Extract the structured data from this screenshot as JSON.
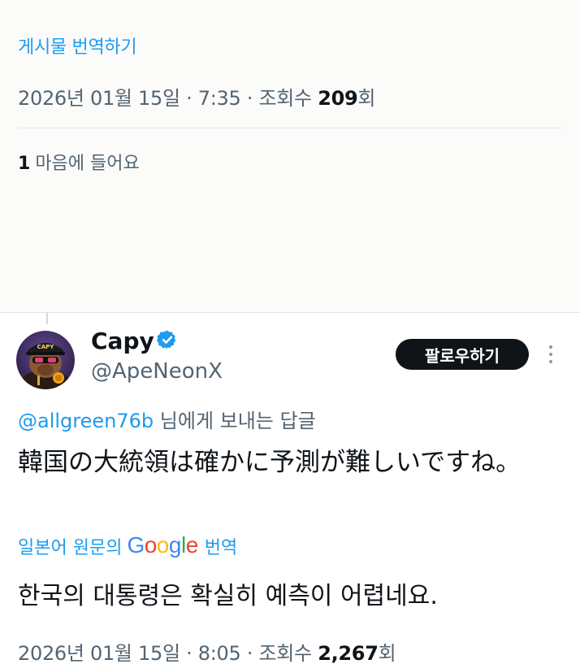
{
  "top_post": {
    "translate_label": "게시물 번역하기",
    "date": "2026년 01월 15일",
    "time": "7:35",
    "views_prefix": "조회수",
    "views_count": "209",
    "views_suffix": "회",
    "likes_count": "1",
    "likes_label": "마음에 들어요"
  },
  "reply": {
    "display_name": "Capy",
    "handle": "@ApeNeonX",
    "follow_label": "팔로우하기",
    "replying_to_mention": "@allgreen76b",
    "replying_to_suffix": "님에게 보내는 답글",
    "original_text": "韓国の大統領は確かに予測が難しいですね。",
    "translated_prefix": "일본어 원문의",
    "translated_suffix": "번역",
    "google_letters": [
      "G",
      "o",
      "o",
      "g",
      "l",
      "e"
    ],
    "translated_text": "한국의 대통령은 확실히 예측이 어렵네요.",
    "date": "2026년 01월 15일",
    "time": "8:05",
    "views_prefix": "조회수",
    "views_count": "2,267",
    "views_suffix": "회",
    "avatar_cap_text": "CAPY"
  },
  "colors": {
    "link": "#1d9bf0",
    "secondary_text": "#536471",
    "primary_text": "#0f1419",
    "follow_button_bg": "#0f1419",
    "verified": "#1d9bf0"
  },
  "icons": {
    "verified": "verified-badge-icon",
    "more": "more-vertical-icon"
  }
}
